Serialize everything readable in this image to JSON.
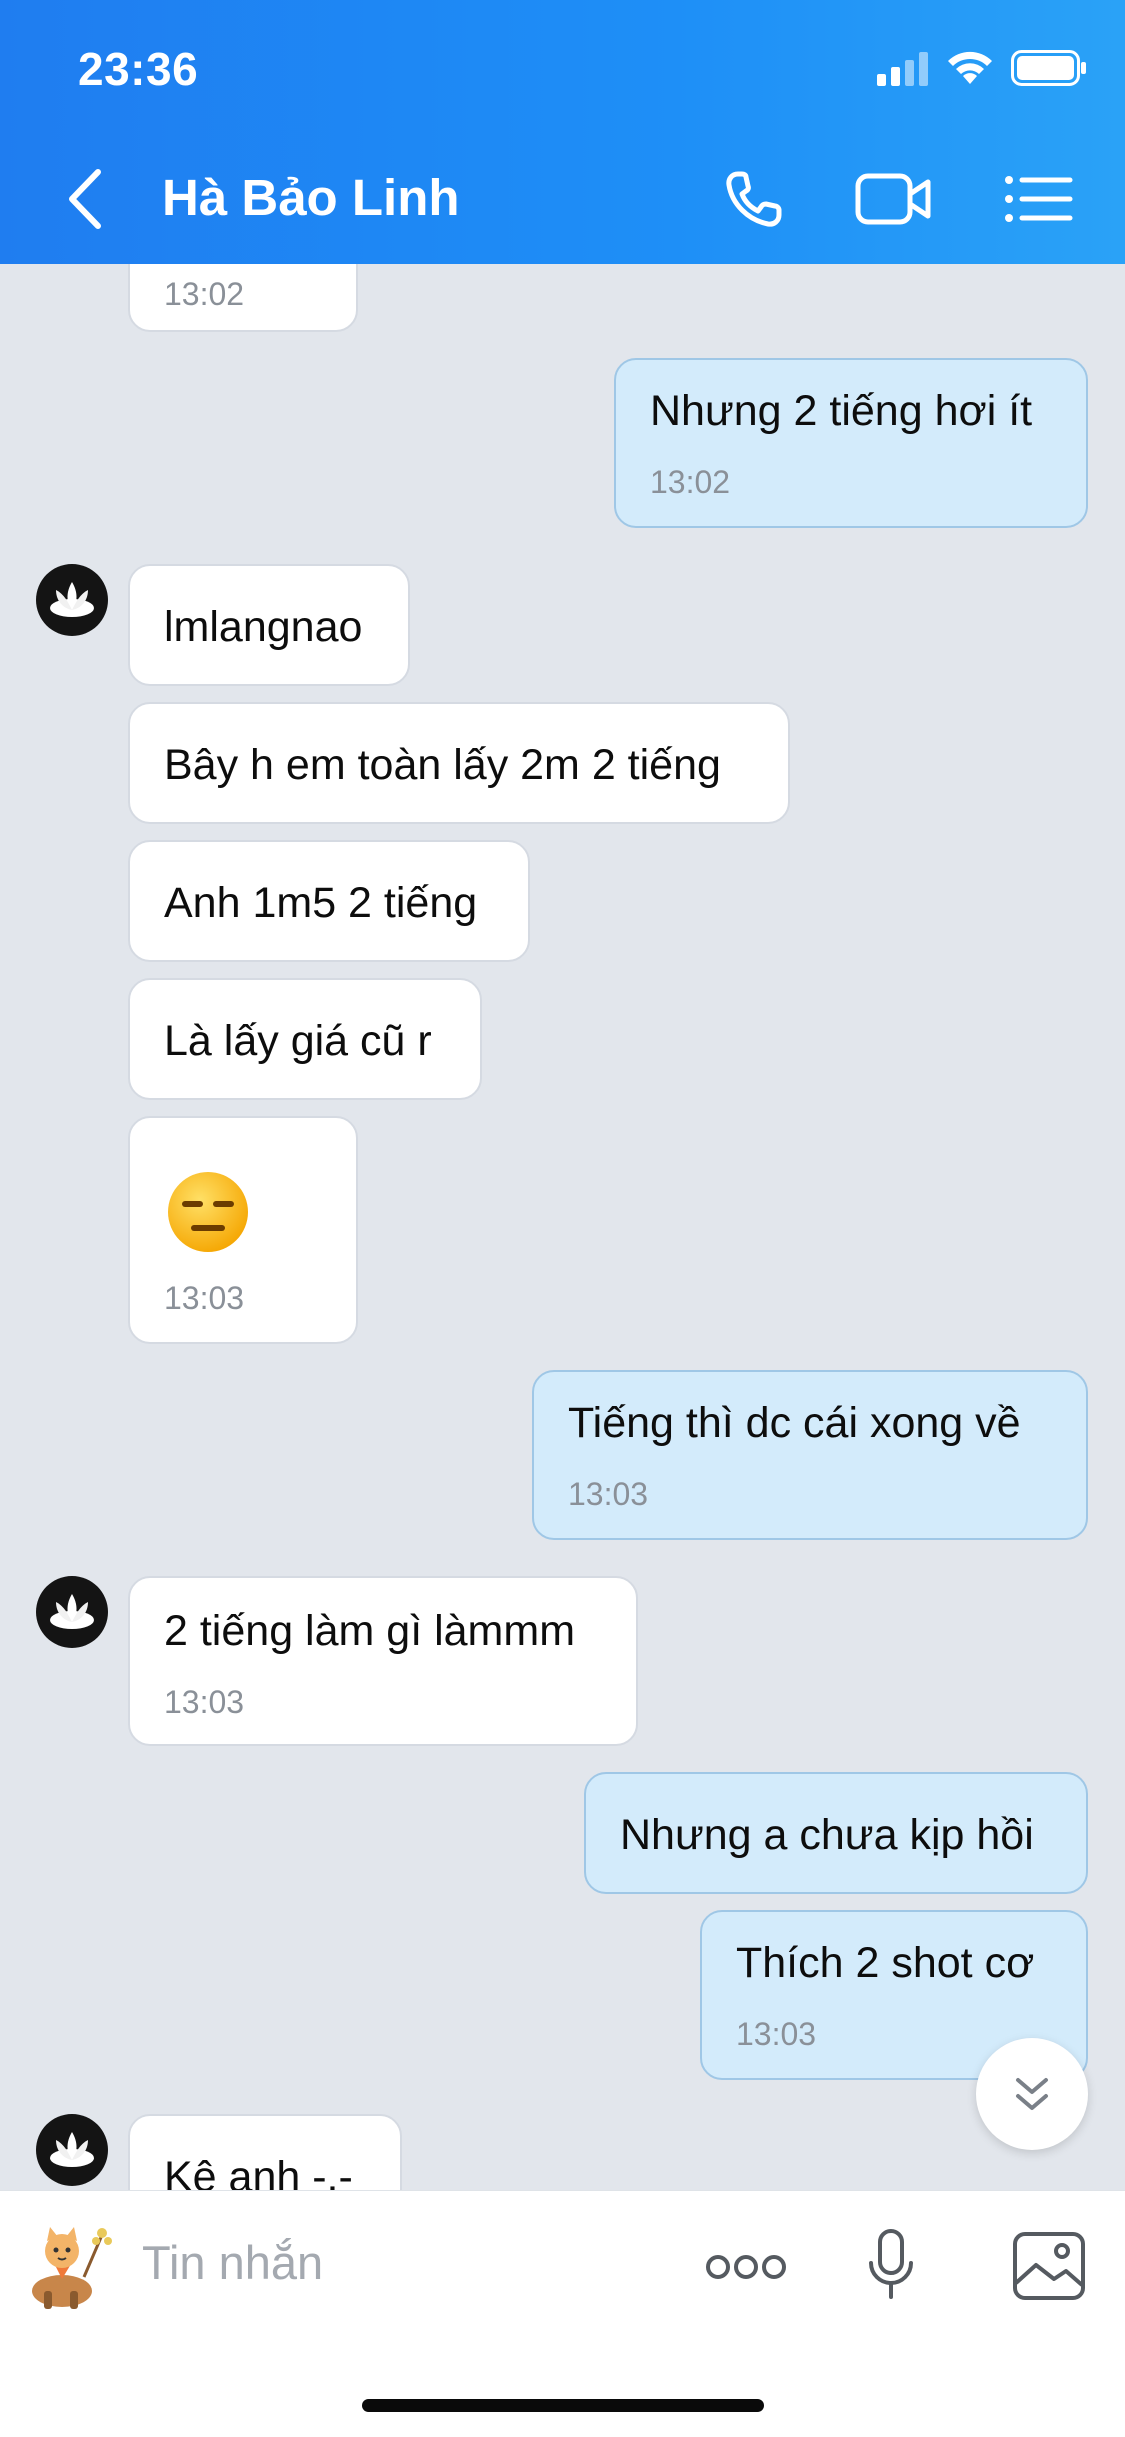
{
  "status_bar": {
    "time": "23:36"
  },
  "header": {
    "contact_name": "Hà Bảo Linh"
  },
  "messages": [
    {
      "dir": "in",
      "text": "",
      "time": "13:02"
    },
    {
      "dir": "out",
      "text": "Nhưng 2 tiếng hơi ít",
      "time": "13:02"
    },
    {
      "dir": "in",
      "text": "lmlangnao",
      "time": ""
    },
    {
      "dir": "in",
      "text": "Bây h em toàn lấy 2m 2 tiếng",
      "time": ""
    },
    {
      "dir": "in",
      "text": "Anh 1m5 2 tiếng",
      "time": ""
    },
    {
      "dir": "in",
      "text": "Là lấy giá cũ r",
      "time": ""
    },
    {
      "dir": "in",
      "text": "",
      "emoji": "expressionless-face",
      "time": "13:03"
    },
    {
      "dir": "out",
      "text": "Tiếng thì dc cái xong về",
      "time": "13:03"
    },
    {
      "dir": "in",
      "text": "2 tiếng làm gì làmmm",
      "time": "13:03"
    },
    {
      "dir": "out",
      "text": "Nhưng a chưa kịp hồi",
      "time": ""
    },
    {
      "dir": "out",
      "text": "Thích 2 shot cơ",
      "time": "13:03"
    },
    {
      "dir": "in",
      "text": "Kê anh -.-",
      "time": ""
    }
  ],
  "composer": {
    "placeholder": "Tin nhắn"
  },
  "icons": {
    "back": "chevron-left-icon",
    "call": "phone-icon",
    "video": "video-camera-icon",
    "menu": "list-menu-icon",
    "more": "more-dots-icon",
    "mic": "microphone-icon",
    "image": "image-icon",
    "scroll": "double-chevron-down-icon"
  },
  "colors": {
    "header": "#1f87f4",
    "outgoing_bubble": "#d3ebfb",
    "incoming_bubble": "#ffffff",
    "chat_bg": "#e2e6ec"
  }
}
